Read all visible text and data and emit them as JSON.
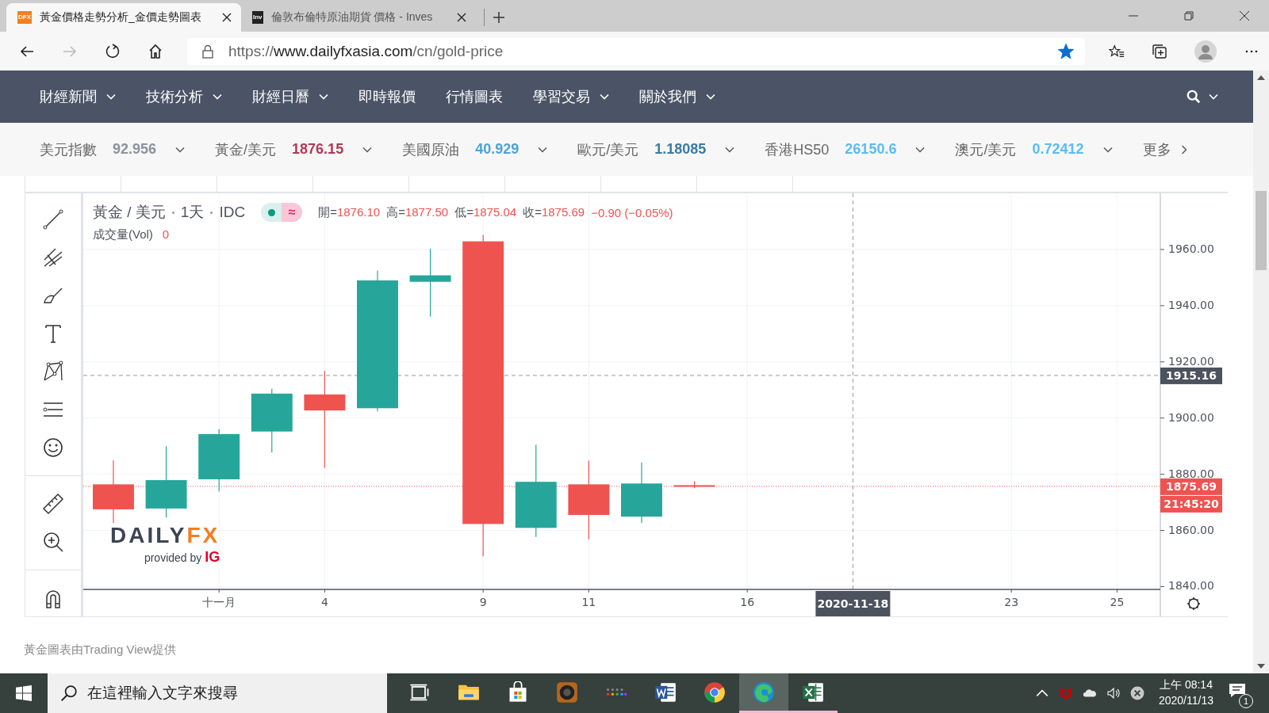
{
  "browser": {
    "tabs": [
      {
        "favicon": "DFX",
        "title": "黃金價格走勢分析_金價走勢圖表",
        "selected": true
      },
      {
        "favicon": "Inv",
        "title": "倫敦布倫特原油期貨 價格 - Inves",
        "selected": false
      }
    ],
    "address": {
      "scheme": "https://",
      "host": "www.dailyfxasia.com",
      "path": "/cn/gold-price",
      "bookmarked": true
    }
  },
  "nav": {
    "items": [
      {
        "label": "財經新聞",
        "dropdown": true
      },
      {
        "label": "技術分析",
        "dropdown": true
      },
      {
        "label": "財經日曆",
        "dropdown": true
      },
      {
        "label": "即時報價",
        "dropdown": false
      },
      {
        "label": "行情圖表",
        "dropdown": false
      },
      {
        "label": "學習交易",
        "dropdown": true
      },
      {
        "label": "關於我們",
        "dropdown": true
      }
    ]
  },
  "ticker": {
    "items": [
      {
        "name": "美元指數",
        "value": "92.956",
        "color": "#8a939e"
      },
      {
        "name": "黃金/美元",
        "value": "1876.15",
        "color": "#b03a55"
      },
      {
        "name": "美國原油",
        "value": "40.929",
        "color": "#4aa3df"
      },
      {
        "name": "歐元/美元",
        "value": "1.18085",
        "color": "#3a7ca5"
      },
      {
        "name": "香港HS50",
        "value": "26150.6",
        "color": "#5bbcf0"
      },
      {
        "name": "澳元/美元",
        "value": "0.72412",
        "color": "#5bbcf0"
      }
    ],
    "more": "更多"
  },
  "chart": {
    "symbol": "黃金 / 美元",
    "interval": "1天",
    "source": "IDC",
    "toggle_icon": "≈",
    "ohlc": [
      {
        "label": "開=",
        "value": "1876.10"
      },
      {
        "label": "高=",
        "value": "1877.50"
      },
      {
        "label": "低=",
        "value": "1875.04"
      },
      {
        "label": "收=",
        "value": "1875.69"
      }
    ],
    "change": "−0.90 (−0.05%)",
    "volume_label": "成交量(Vol)",
    "volume_value": "0",
    "logo": {
      "main": "DAILY",
      "accent": "FX",
      "tagline": "provided by",
      "brand": "IG"
    },
    "countdown": "21:45:20",
    "chart_data": {
      "type": "candlestick",
      "categories": [
        null,
        null,
        "十一月",
        null,
        "4",
        null,
        null,
        "9",
        null,
        "11",
        null,
        null,
        "16",
        null,
        null,
        null,
        null,
        "23",
        null,
        "25"
      ],
      "series": [
        {
          "ohlc": [
            [
              1876.4,
              1885,
              1862.6,
              1867.5
            ],
            [
              1867.8,
              1890,
              1864.6,
              1877.9
            ],
            [
              1878.2,
              1896,
              1873.8,
              1894.3
            ],
            [
              1895.2,
              1910.4,
              1887.7,
              1908.7
            ],
            [
              1908.4,
              1916.8,
              1882.2,
              1902.7
            ],
            [
              1903.5,
              1952.5,
              1902.4,
              1949
            ],
            [
              1948.5,
              1960.3,
              1936.1,
              1950.8
            ],
            [
              1962.9,
              1965.2,
              1850.8,
              1862.3
            ],
            [
              1860.9,
              1890.5,
              1857.7,
              1877.3
            ],
            [
              1876.4,
              1884.8,
              1856.8,
              1865.5
            ],
            [
              1864.9,
              1884.2,
              1862.6,
              1876.7
            ],
            [
              1876.1,
              1877.5,
              1875.04,
              1875.69
            ],
            null,
            null,
            null,
            null,
            null,
            null,
            null,
            null
          ]
        }
      ],
      "ylim": [
        1839,
        1980
      ],
      "yticks": [
        {
          "value": 1840,
          "label": "1840.00"
        },
        {
          "value": 1860,
          "label": "1860.00"
        },
        {
          "value": 1880,
          "label": "1880.00"
        },
        {
          "value": 1900,
          "label": "1900.00"
        },
        {
          "value": 1920,
          "label": "1920.00"
        },
        {
          "value": 1940,
          "label": "1940.00"
        },
        {
          "value": 1960,
          "label": "1960.00"
        }
      ],
      "grid": true,
      "annotations": [
        {
          "text": "2020-11-18"
        }
      ],
      "ref_lines": [
        {
          "axis": "y",
          "value": 1915.16,
          "label": "1915.16"
        },
        {
          "axis": "y",
          "value": 1875.69,
          "label": "1875.69"
        }
      ]
    }
  },
  "footer": "黃金圖表由Trading View提供",
  "taskbar": {
    "search_placeholder": "在這裡輸入文字來搜尋",
    "apps": [
      {
        "kind": "taskview",
        "active": false,
        "running": false
      },
      {
        "kind": "files",
        "active": false,
        "running": false
      },
      {
        "kind": "store",
        "active": false,
        "running": false
      },
      {
        "kind": "speaker",
        "active": false,
        "running": false
      },
      {
        "kind": "dots",
        "active": false,
        "running": false
      },
      {
        "kind": "word",
        "active": false,
        "running": false
      },
      {
        "kind": "chrome",
        "active": false,
        "running": false
      },
      {
        "kind": "edge",
        "active": true,
        "running": true
      },
      {
        "kind": "excel",
        "active": false,
        "running": true
      }
    ],
    "time": "上午 08:14",
    "date": "2020/11/13",
    "notifications": "1"
  }
}
